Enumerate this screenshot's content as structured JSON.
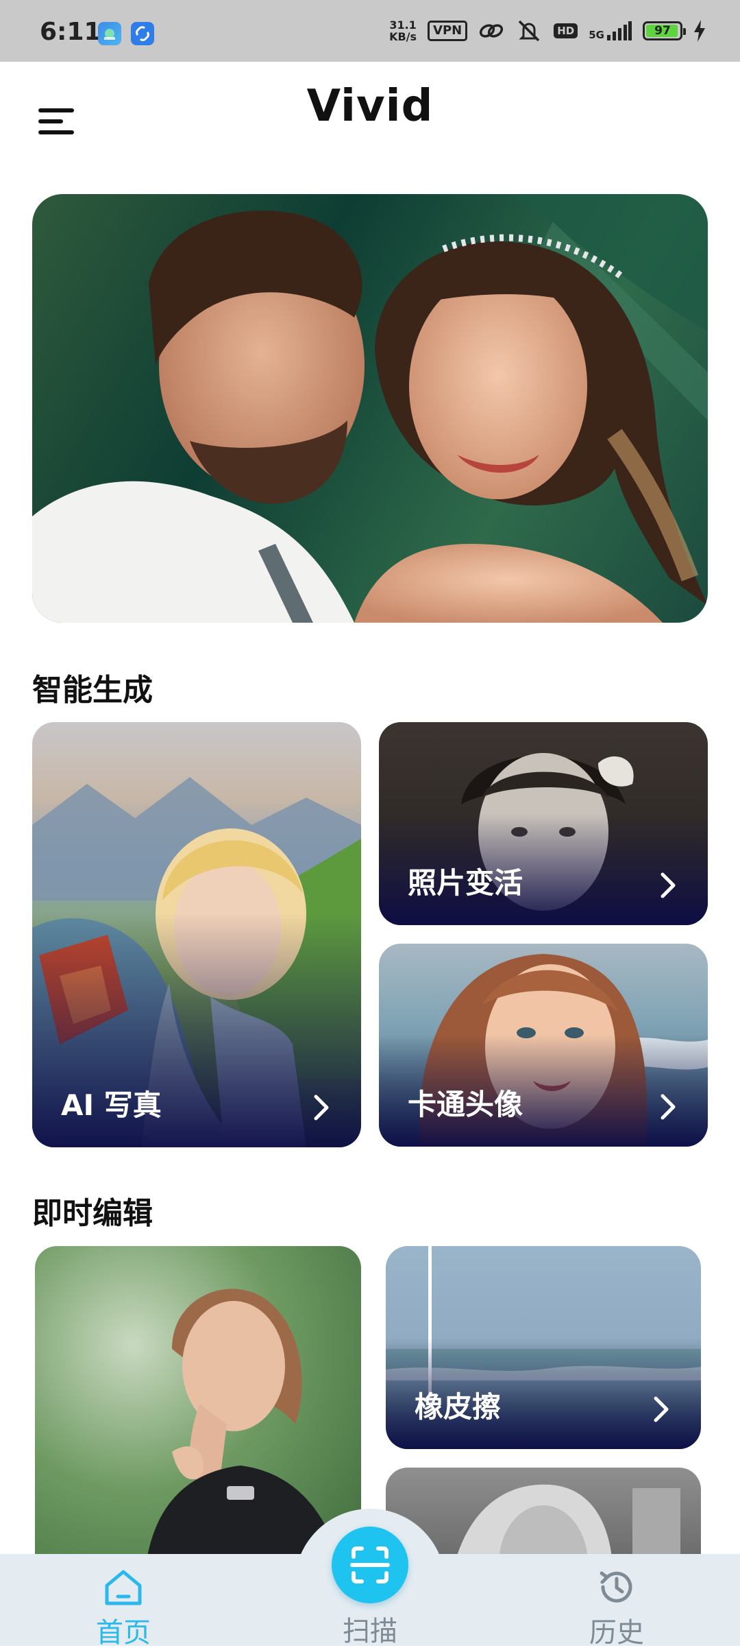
{
  "status_bar": {
    "time": "6:11",
    "net_speed_value": "31.1",
    "net_speed_unit": "KB/s",
    "vpn": "VPN",
    "hd": "HD",
    "network": "5G",
    "battery": "97",
    "battery_level": 0.97
  },
  "header": {
    "title": "Vivid"
  },
  "sections": {
    "smart": {
      "title": "智能生成",
      "cards": [
        {
          "label": "AI 写真"
        },
        {
          "label": "照片变活"
        },
        {
          "label": "卡通头像"
        }
      ]
    },
    "edit": {
      "title": "即时编辑",
      "cards": [
        {
          "label": ""
        },
        {
          "label": "橡皮擦"
        },
        {
          "label": ""
        }
      ]
    }
  },
  "bottom_nav": {
    "home": "首页",
    "scan": "扫描",
    "history": "历史"
  },
  "colors": {
    "accent": "#1ec4ef",
    "nav_active": "#2bb8ec",
    "nav_inactive": "#7e8a94"
  }
}
